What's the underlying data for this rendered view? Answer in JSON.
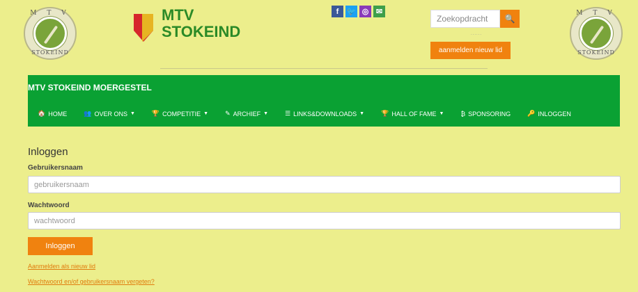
{
  "header": {
    "seal_top_text": "M T V",
    "seal_bottom_text": "STOKEIND",
    "brand_line1": "MTV",
    "brand_line2": "STOKEIND",
    "social": [
      {
        "name": "facebook-icon",
        "glyph": "f"
      },
      {
        "name": "twitter-icon",
        "glyph": "🐦"
      },
      {
        "name": "instagram-icon",
        "glyph": "◎"
      },
      {
        "name": "email-icon",
        "glyph": "✉"
      }
    ],
    "search_placeholder": "Zoekopdracht",
    "search_icon": "search-icon",
    "dots": "......",
    "join_label": "aanmelden nieuw lid"
  },
  "nav": {
    "site_name": "MTV STOKEIND MOERGESTEL",
    "items": [
      {
        "label": "HOME",
        "icon": "🏠",
        "caret": false
      },
      {
        "label": "OVER ONS",
        "icon": "👥",
        "caret": true
      },
      {
        "label": "COMPETITIE",
        "icon": "🏆",
        "caret": true
      },
      {
        "label": "ARCHIEF",
        "icon": "✎",
        "caret": true
      },
      {
        "label": "LINKS&DOWNLOADS",
        "icon": "☰",
        "caret": true
      },
      {
        "label": "HALL OF FAME",
        "icon": "🏆",
        "caret": true
      },
      {
        "label": "SPONSORING",
        "icon": "₿",
        "caret": false
      },
      {
        "label": "INLOGGEN",
        "icon": "🔑",
        "caret": false
      }
    ]
  },
  "login": {
    "title": "Inloggen",
    "username_label": "Gebruikersnaam",
    "username_placeholder": "gebruikersnaam",
    "password_label": "Wachtwoord",
    "password_placeholder": "wachtwoord",
    "submit_label": "Inloggen",
    "register_link": "Aanmelden als nieuw lid",
    "forgot_link": "Wachtwoord en/of gebruikersnaam vergeten?"
  },
  "colors": {
    "background": "#ecee8c",
    "nav_green": "#0aa133",
    "accent_orange": "#f0820f",
    "brand_green": "#2b8a27"
  }
}
